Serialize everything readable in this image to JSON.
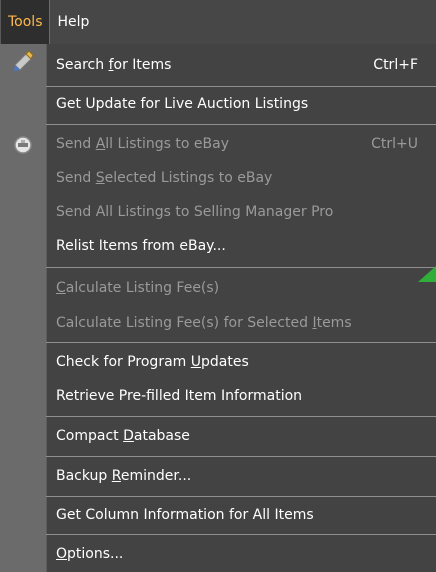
{
  "menubar": {
    "tools": "Tools",
    "help": "Help"
  },
  "menu": {
    "items": [
      {
        "pre": "Search ",
        "accel": "f",
        "post": "or Items",
        "shortcut": "Ctrl+F",
        "enabled": true
      },
      {
        "pre": "Get Update for Live Auction Listings",
        "accel": "",
        "post": "",
        "shortcut": "",
        "enabled": true
      },
      {
        "pre": "Send ",
        "accel": "A",
        "post": "ll Listings to eBay",
        "shortcut": "Ctrl+U",
        "enabled": false
      },
      {
        "pre": "Send ",
        "accel": "S",
        "post": "elected Listings to eBay",
        "shortcut": "",
        "enabled": false
      },
      {
        "pre": "Send All Listings to Selling Manager Pro",
        "accel": "",
        "post": "",
        "shortcut": "",
        "enabled": false
      },
      {
        "pre": "Relist Items from eBay...",
        "accel": "",
        "post": "",
        "shortcut": "",
        "enabled": true
      },
      {
        "pre": "",
        "accel": "C",
        "post": "alculate Listing Fee(s)",
        "shortcut": "",
        "enabled": false
      },
      {
        "pre": "Calculate Listing Fee(s) for Selected ",
        "accel": "I",
        "post": "tems",
        "shortcut": "",
        "enabled": false
      },
      {
        "pre": "Check for Program ",
        "accel": "U",
        "post": "pdates",
        "shortcut": "",
        "enabled": true
      },
      {
        "pre": "Retrieve Pre-filled Item Information",
        "accel": "",
        "post": "",
        "shortcut": "",
        "enabled": true
      },
      {
        "pre": "Compact ",
        "accel": "D",
        "post": "atabase",
        "shortcut": "",
        "enabled": true
      },
      {
        "pre": "Backup ",
        "accel": "R",
        "post": "eminder...",
        "shortcut": "",
        "enabled": true
      },
      {
        "pre": "Get Column Information for All Items",
        "accel": "",
        "post": "",
        "shortcut": "",
        "enabled": true
      },
      {
        "pre": "",
        "accel": "O",
        "post": "ptions...",
        "shortcut": "",
        "enabled": true
      }
    ]
  },
  "icons": {
    "search": "search-items-icon",
    "send": "send-listings-icon"
  },
  "colors": {
    "active_menu_text": "#ffb84d",
    "disabled_text": "#9a9a9a",
    "accent_arrow": "#2fae3a"
  }
}
